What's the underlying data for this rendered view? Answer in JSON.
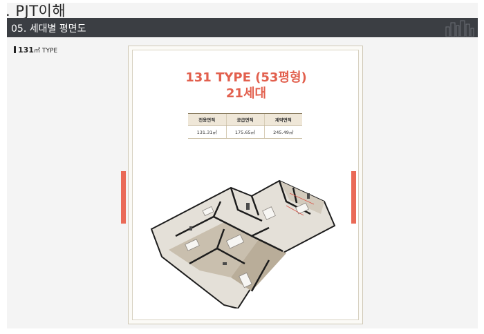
{
  "header": {
    "page_title": ". PJT이해",
    "section_title": "05. 세대별 평면도"
  },
  "type_label": {
    "number": "131",
    "unit": "㎡",
    "word": "TYPE"
  },
  "document": {
    "title_line1": "131 TYPE (53평형)",
    "title_line2": "21세대",
    "table": {
      "headers": [
        "전용면적",
        "공급면적",
        "계약면적"
      ],
      "values": [
        "131.31㎡",
        "175.65㎡",
        "245.49㎡"
      ]
    }
  },
  "colors": {
    "accent": "#e2604e",
    "section_bar": "#3b3e43"
  },
  "icons": {
    "skyline": "city-skyline-icon",
    "floor_plan": "3d-floor-plan-illustration"
  }
}
